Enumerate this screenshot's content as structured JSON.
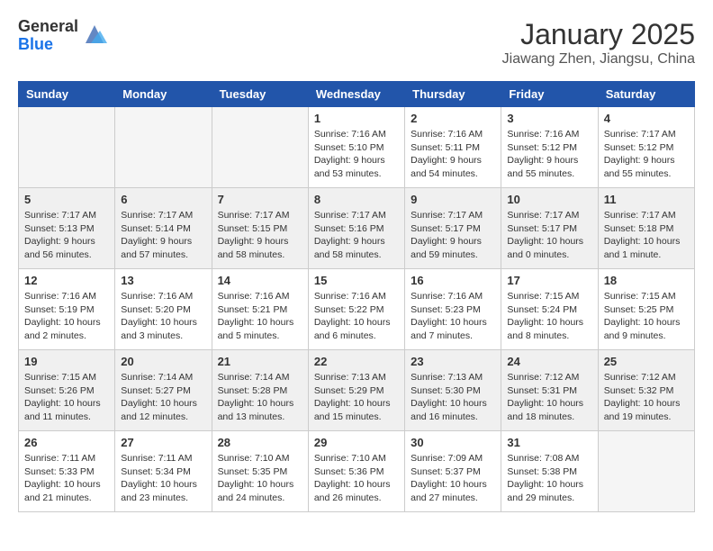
{
  "header": {
    "logo_general": "General",
    "logo_blue": "Blue",
    "title": "January 2025",
    "subtitle": "Jiawang Zhen, Jiangsu, China"
  },
  "days_of_week": [
    "Sunday",
    "Monday",
    "Tuesday",
    "Wednesday",
    "Thursday",
    "Friday",
    "Saturday"
  ],
  "weeks": [
    [
      {
        "num": "",
        "info": ""
      },
      {
        "num": "",
        "info": ""
      },
      {
        "num": "",
        "info": ""
      },
      {
        "num": "1",
        "info": "Sunrise: 7:16 AM\nSunset: 5:10 PM\nDaylight: 9 hours and 53 minutes."
      },
      {
        "num": "2",
        "info": "Sunrise: 7:16 AM\nSunset: 5:11 PM\nDaylight: 9 hours and 54 minutes."
      },
      {
        "num": "3",
        "info": "Sunrise: 7:16 AM\nSunset: 5:12 PM\nDaylight: 9 hours and 55 minutes."
      },
      {
        "num": "4",
        "info": "Sunrise: 7:17 AM\nSunset: 5:12 PM\nDaylight: 9 hours and 55 minutes."
      }
    ],
    [
      {
        "num": "5",
        "info": "Sunrise: 7:17 AM\nSunset: 5:13 PM\nDaylight: 9 hours and 56 minutes."
      },
      {
        "num": "6",
        "info": "Sunrise: 7:17 AM\nSunset: 5:14 PM\nDaylight: 9 hours and 57 minutes."
      },
      {
        "num": "7",
        "info": "Sunrise: 7:17 AM\nSunset: 5:15 PM\nDaylight: 9 hours and 58 minutes."
      },
      {
        "num": "8",
        "info": "Sunrise: 7:17 AM\nSunset: 5:16 PM\nDaylight: 9 hours and 58 minutes."
      },
      {
        "num": "9",
        "info": "Sunrise: 7:17 AM\nSunset: 5:17 PM\nDaylight: 9 hours and 59 minutes."
      },
      {
        "num": "10",
        "info": "Sunrise: 7:17 AM\nSunset: 5:17 PM\nDaylight: 10 hours and 0 minutes."
      },
      {
        "num": "11",
        "info": "Sunrise: 7:17 AM\nSunset: 5:18 PM\nDaylight: 10 hours and 1 minute."
      }
    ],
    [
      {
        "num": "12",
        "info": "Sunrise: 7:16 AM\nSunset: 5:19 PM\nDaylight: 10 hours and 2 minutes."
      },
      {
        "num": "13",
        "info": "Sunrise: 7:16 AM\nSunset: 5:20 PM\nDaylight: 10 hours and 3 minutes."
      },
      {
        "num": "14",
        "info": "Sunrise: 7:16 AM\nSunset: 5:21 PM\nDaylight: 10 hours and 5 minutes."
      },
      {
        "num": "15",
        "info": "Sunrise: 7:16 AM\nSunset: 5:22 PM\nDaylight: 10 hours and 6 minutes."
      },
      {
        "num": "16",
        "info": "Sunrise: 7:16 AM\nSunset: 5:23 PM\nDaylight: 10 hours and 7 minutes."
      },
      {
        "num": "17",
        "info": "Sunrise: 7:15 AM\nSunset: 5:24 PM\nDaylight: 10 hours and 8 minutes."
      },
      {
        "num": "18",
        "info": "Sunrise: 7:15 AM\nSunset: 5:25 PM\nDaylight: 10 hours and 9 minutes."
      }
    ],
    [
      {
        "num": "19",
        "info": "Sunrise: 7:15 AM\nSunset: 5:26 PM\nDaylight: 10 hours and 11 minutes."
      },
      {
        "num": "20",
        "info": "Sunrise: 7:14 AM\nSunset: 5:27 PM\nDaylight: 10 hours and 12 minutes."
      },
      {
        "num": "21",
        "info": "Sunrise: 7:14 AM\nSunset: 5:28 PM\nDaylight: 10 hours and 13 minutes."
      },
      {
        "num": "22",
        "info": "Sunrise: 7:13 AM\nSunset: 5:29 PM\nDaylight: 10 hours and 15 minutes."
      },
      {
        "num": "23",
        "info": "Sunrise: 7:13 AM\nSunset: 5:30 PM\nDaylight: 10 hours and 16 minutes."
      },
      {
        "num": "24",
        "info": "Sunrise: 7:12 AM\nSunset: 5:31 PM\nDaylight: 10 hours and 18 minutes."
      },
      {
        "num": "25",
        "info": "Sunrise: 7:12 AM\nSunset: 5:32 PM\nDaylight: 10 hours and 19 minutes."
      }
    ],
    [
      {
        "num": "26",
        "info": "Sunrise: 7:11 AM\nSunset: 5:33 PM\nDaylight: 10 hours and 21 minutes."
      },
      {
        "num": "27",
        "info": "Sunrise: 7:11 AM\nSunset: 5:34 PM\nDaylight: 10 hours and 23 minutes."
      },
      {
        "num": "28",
        "info": "Sunrise: 7:10 AM\nSunset: 5:35 PM\nDaylight: 10 hours and 24 minutes."
      },
      {
        "num": "29",
        "info": "Sunrise: 7:10 AM\nSunset: 5:36 PM\nDaylight: 10 hours and 26 minutes."
      },
      {
        "num": "30",
        "info": "Sunrise: 7:09 AM\nSunset: 5:37 PM\nDaylight: 10 hours and 27 minutes."
      },
      {
        "num": "31",
        "info": "Sunrise: 7:08 AM\nSunset: 5:38 PM\nDaylight: 10 hours and 29 minutes."
      },
      {
        "num": "",
        "info": ""
      }
    ]
  ]
}
